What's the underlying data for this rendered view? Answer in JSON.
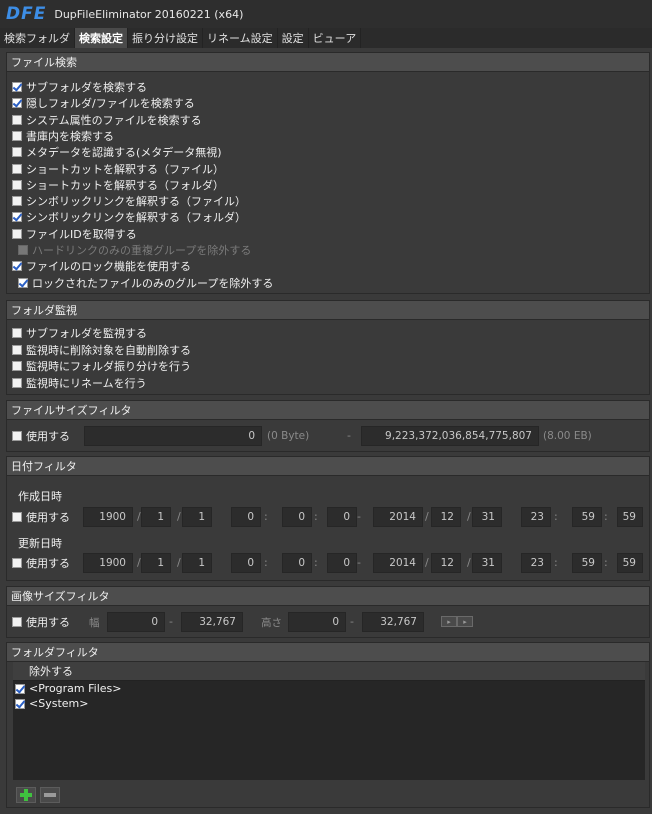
{
  "window": {
    "logo": "DFE",
    "title": "DupFileEliminator 20160221 (x64)"
  },
  "tabs": [
    {
      "label": "検索フォルダ",
      "active": false
    },
    {
      "label": "検索設定",
      "active": true
    },
    {
      "label": "振り分け設定",
      "active": false
    },
    {
      "label": "リネーム設定",
      "active": false
    },
    {
      "label": "設定",
      "active": false
    },
    {
      "label": "ビューア",
      "active": false
    }
  ],
  "file_search": {
    "header": "ファイル検索",
    "options": [
      {
        "label": "サブフォルダを検索する",
        "checked": true
      },
      {
        "label": "隠しフォルダ/ファイルを検索する",
        "checked": true
      },
      {
        "label": "システム属性のファイルを検索する",
        "checked": false
      },
      {
        "label": "書庫内を検索する",
        "checked": false
      },
      {
        "label": "メタデータを認識する(メタデータ無視)",
        "checked": false
      },
      {
        "label": "ショートカットを解釈する（ファイル）",
        "checked": false
      },
      {
        "label": "ショートカットを解釈する（フォルダ）",
        "checked": false
      },
      {
        "label": "シンボリックリンクを解釈する（ファイル）",
        "checked": false
      },
      {
        "label": "シンボリックリンクを解釈する（フォルダ）",
        "checked": true
      },
      {
        "label": "ファイルIDを取得する",
        "checked": false
      },
      {
        "label": "ハードリンクのみの重複グループを除外する",
        "checked": false,
        "disabled": true
      },
      {
        "label": "ファイルのロック機能を使用する",
        "checked": true
      },
      {
        "label": "ロックされたファイルのみのグループを除外する",
        "checked": true
      }
    ]
  },
  "folder_watch": {
    "header": "フォルダ監視",
    "options": [
      {
        "label": "サブフォルダを監視する",
        "checked": false
      },
      {
        "label": "監視時に削除対象を自動削除する",
        "checked": false
      },
      {
        "label": "監視時にフォルダ振り分けを行う",
        "checked": false
      },
      {
        "label": "監視時にリネームを行う",
        "checked": false
      }
    ]
  },
  "file_size_filter": {
    "header": "ファイルサイズフィルタ",
    "use_label": "使用する",
    "use_checked": false,
    "min_value": "0",
    "min_unit": "(0 Byte)",
    "separator": "-",
    "max_value": "9,223,372,036,854,775,807",
    "max_unit": "(8.00 EB)"
  },
  "date_filter": {
    "header": "日付フィルタ",
    "created": {
      "title": "作成日時",
      "use_label": "使用する",
      "use_checked": false,
      "from": [
        "1900",
        "1",
        "1",
        "0",
        "0",
        "0"
      ],
      "to": [
        "2014",
        "12",
        "31",
        "23",
        "59",
        "59"
      ]
    },
    "modified": {
      "title": "更新日時",
      "use_label": "使用する",
      "use_checked": false,
      "from": [
        "1900",
        "1",
        "1",
        "0",
        "0",
        "0"
      ],
      "to": [
        "2014",
        "12",
        "31",
        "23",
        "59",
        "59"
      ]
    },
    "date_sep": "/",
    "time_sep": ":",
    "range_sep": "-"
  },
  "image_size_filter": {
    "header": "画像サイズフィルタ",
    "use_label": "使用する",
    "use_checked": false,
    "width_label": "幅",
    "width_min": "0",
    "width_max": "32,767",
    "height_label": "高さ",
    "height_min": "0",
    "height_max": "32,767",
    "separator": "-"
  },
  "folder_filter": {
    "header": "フォルダフィルタ",
    "column_header": "除外する",
    "items": [
      {
        "label": "<Program Files>",
        "checked": true
      },
      {
        "label": "<System>",
        "checked": true
      }
    ],
    "add_icon": "plus-icon",
    "remove_icon": "minus-icon"
  },
  "colors": {
    "accent": "#3d8ee6",
    "add_green": "#3fc23f"
  }
}
